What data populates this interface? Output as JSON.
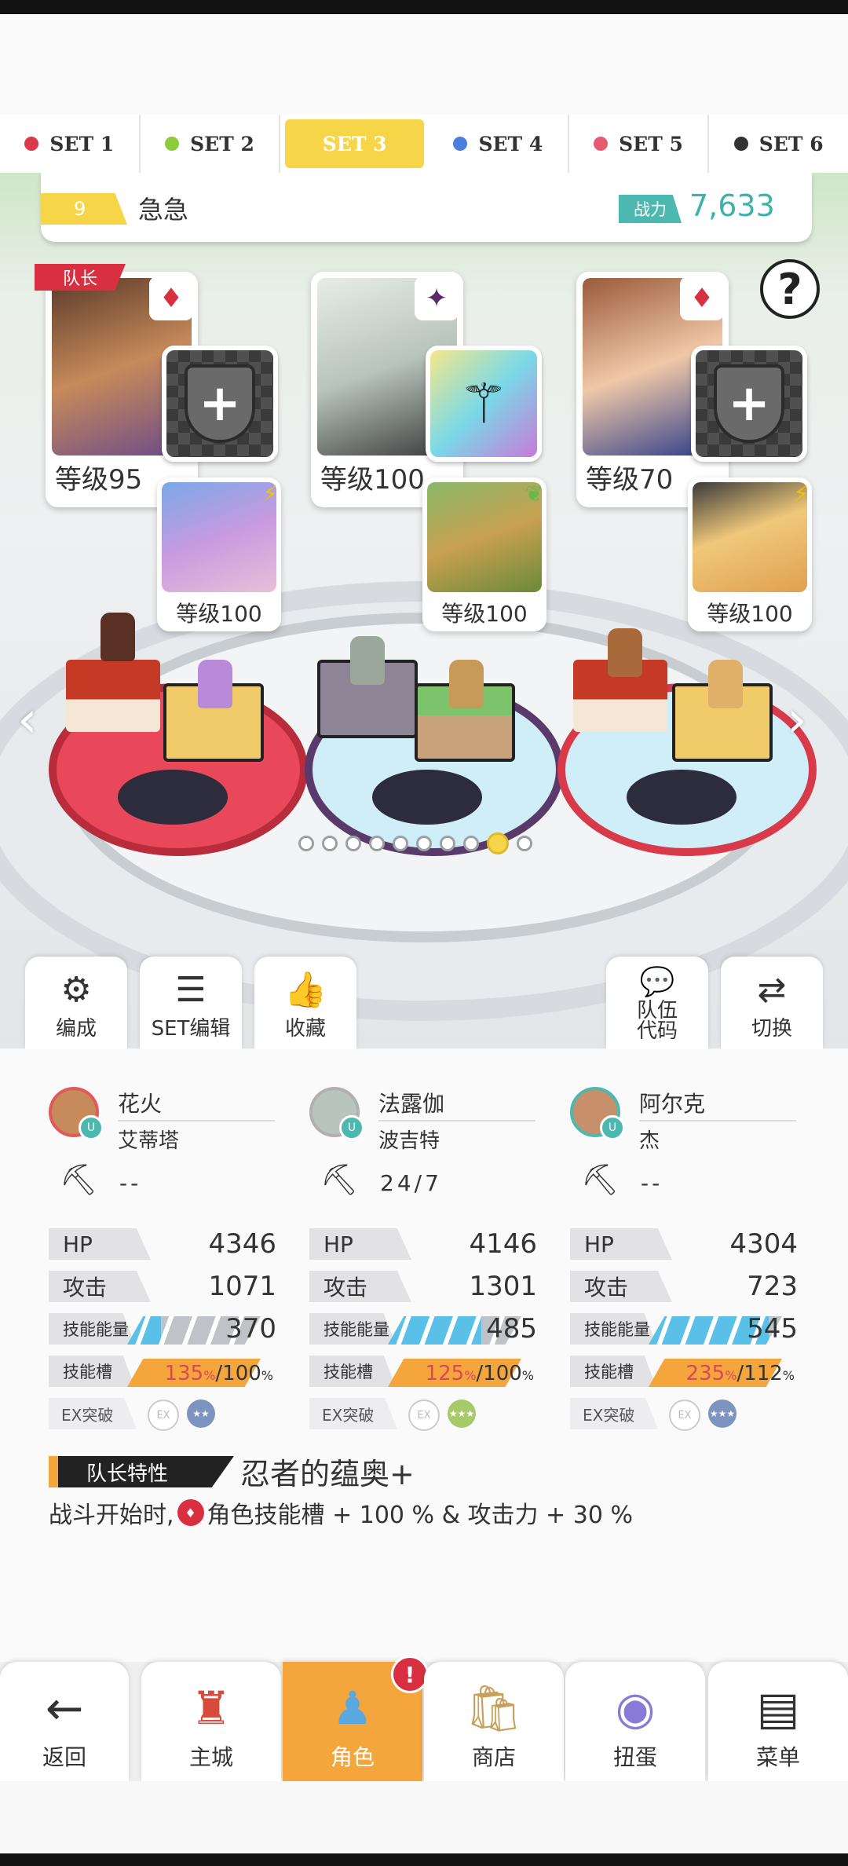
{
  "set_tabs": [
    {
      "label": "SET 1",
      "color": "#d83a4a"
    },
    {
      "label": "SET 2",
      "color": "#8ccc3c"
    },
    {
      "label": "SET 3",
      "color": "#f7d548"
    },
    {
      "label": "SET 4",
      "color": "#4c7ee0"
    },
    {
      "label": "SET 5",
      "color": "#e85a70"
    },
    {
      "label": "SET 6",
      "color": "#333333"
    }
  ],
  "active_set": 3,
  "team": {
    "number": "9",
    "name": "急急",
    "power_label": "战力",
    "power_value": "7,633"
  },
  "leader_tag": "队长",
  "help": "?",
  "heroes": [
    {
      "level": "等级95",
      "element_icon": "fire-diamond-icon",
      "element_glyph": "♦",
      "equip": "empty",
      "sub_level": "等级100",
      "sub_element_glyph": "⚡"
    },
    {
      "level": "等级100",
      "element_icon": "dark-star-icon",
      "element_glyph": "✦",
      "equip": "staff",
      "sub_level": "等级100",
      "sub_element_glyph": "❦"
    },
    {
      "level": "等级70",
      "element_icon": "fire-diamond-icon",
      "element_glyph": "♦",
      "equip": "empty",
      "sub_level": "等级100",
      "sub_element_glyph": "⚡"
    }
  ],
  "pager": {
    "count": 10,
    "active": 9
  },
  "actions": {
    "compose": "编成",
    "set_edit": "SET编辑",
    "favorite": "收藏",
    "team_code": "队伍\n代码",
    "switch": "切换"
  },
  "stats": [
    {
      "name": "花火",
      "partner": "艾蒂塔",
      "tool": "--",
      "hp": "4346",
      "atk": "1071",
      "skill_energy": "370",
      "skill_energy_fill": 0.25,
      "slot_a": "135",
      "slot_b": "100",
      "ex_badge_color": "#7c94bf"
    },
    {
      "name": "法露伽",
      "partner": "波吉特",
      "tool": "24/7",
      "hp": "4146",
      "atk": "1301",
      "skill_energy": "485",
      "skill_energy_fill": 0.7,
      "slot_a": "125",
      "slot_b": "100",
      "ex_badge_color": "#a6c96a"
    },
    {
      "name": "阿尔克",
      "partner": "杰",
      "tool": "--",
      "hp": "4304",
      "atk": "723",
      "skill_energy": "545",
      "skill_energy_fill": 0.9,
      "slot_a": "235",
      "slot_b": "112",
      "ex_badge_color": "#7c94bf"
    }
  ],
  "stat_labels": {
    "hp": "HP",
    "atk": "攻击",
    "energy": "技能能量",
    "slot": "技能槽",
    "ex": "EX突破",
    "pct": "%",
    "slash": "/"
  },
  "leader_trait": {
    "tag": "队长特性",
    "name": "忍者的蕴奥+",
    "desc_prefix": "战斗开始时,",
    "desc_suffix": "角色技能槽 + 100 % & 攻击力 + 30 %"
  },
  "nav": {
    "back": "返回",
    "home": "主城",
    "character": "角色",
    "shop": "商店",
    "gacha": "扭蛋",
    "menu": "菜单",
    "notification": "!"
  }
}
